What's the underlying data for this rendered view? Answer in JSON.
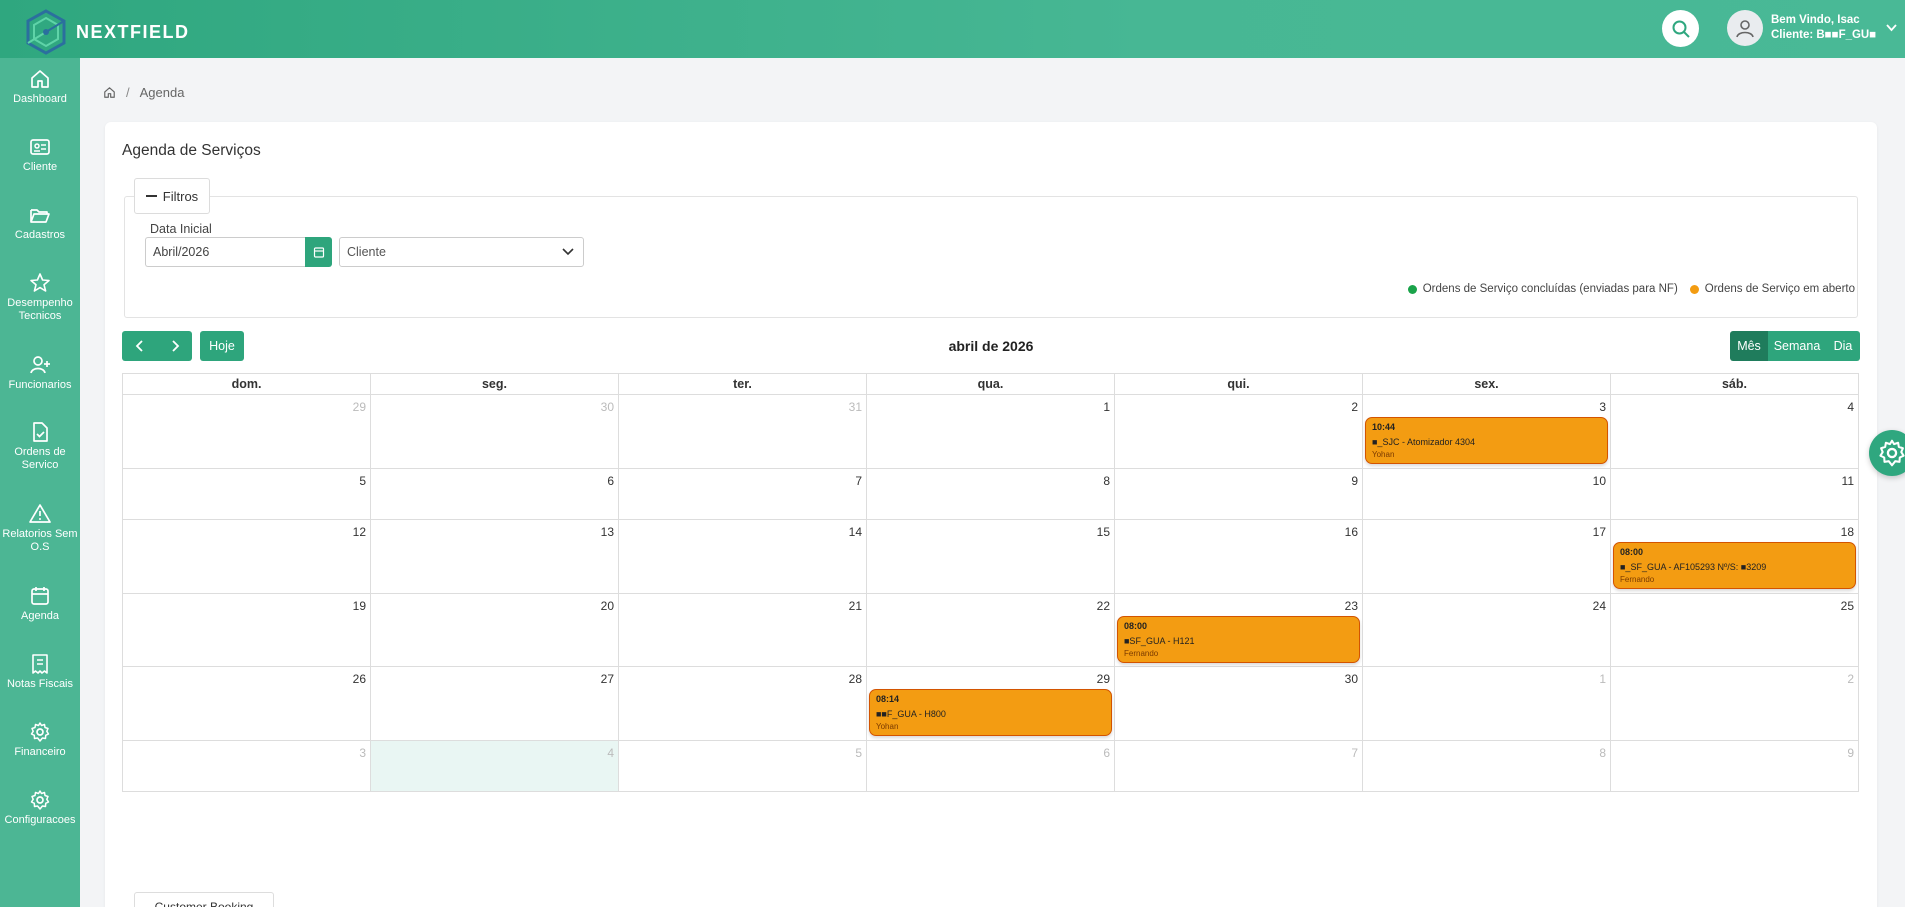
{
  "brand": {
    "name": "NEXTFIELD"
  },
  "user": {
    "greeting": "Bem Vindo, Isac",
    "client": "Cliente: B■■F_GU■"
  },
  "sidebar": {
    "items": [
      {
        "label": "Dashboard",
        "icon": "home-icon"
      },
      {
        "label": "Cliente",
        "icon": "id-card-icon"
      },
      {
        "label": "Cadastros",
        "icon": "folder-open-icon"
      },
      {
        "label": "Desempenho Tecnicos",
        "icon": "star-icon"
      },
      {
        "label": "Funcionarios",
        "icon": "user-plus-icon"
      },
      {
        "label": "Ordens de Servico",
        "icon": "file-check-icon"
      },
      {
        "label": "Relatorios Sem O.S",
        "icon": "warning-icon"
      },
      {
        "label": "Agenda",
        "icon": "calendar-icon"
      },
      {
        "label": "Notas Fiscais",
        "icon": "receipt-icon"
      },
      {
        "label": "Financeiro",
        "icon": "gear-icon"
      },
      {
        "label": "Configuracoes",
        "icon": "gear-icon"
      }
    ]
  },
  "breadcrumb": {
    "current": "Agenda"
  },
  "page": {
    "title": "Agenda de Serviços"
  },
  "filters": {
    "toggle_label": "Filtros",
    "date_label": "Data Inicial",
    "date_value": "Abril/2026",
    "client_placeholder": "Cliente",
    "legend": [
      {
        "label": "Ordens de Serviço concluídas (enviadas para NF)",
        "color": "#1aa34a"
      },
      {
        "label": "Ordens de Serviço em aberto",
        "color": "#f39c12"
      }
    ]
  },
  "calendar": {
    "today_label": "Hoje",
    "title": "abril de 2026",
    "views": [
      "Mês",
      "Semana",
      "Dia"
    ],
    "active_view": "Mês",
    "weekdays": [
      "dom.",
      "seg.",
      "ter.",
      "qua.",
      "qui.",
      "sex.",
      "sáb."
    ],
    "weeks": [
      {
        "days": [
          {
            "n": "29",
            "other": true
          },
          {
            "n": "30",
            "other": true
          },
          {
            "n": "31",
            "other": true
          },
          {
            "n": "1"
          },
          {
            "n": "2"
          },
          {
            "n": "3",
            "event": {
              "time": "10:44",
              "title": "■_SJC - Atomizador 4304",
              "tech": "Yohan"
            }
          },
          {
            "n": "4"
          }
        ]
      },
      {
        "days": [
          {
            "n": "5"
          },
          {
            "n": "6"
          },
          {
            "n": "7"
          },
          {
            "n": "8"
          },
          {
            "n": "9"
          },
          {
            "n": "10"
          },
          {
            "n": "11"
          }
        ]
      },
      {
        "days": [
          {
            "n": "12"
          },
          {
            "n": "13"
          },
          {
            "n": "14"
          },
          {
            "n": "15"
          },
          {
            "n": "16"
          },
          {
            "n": "17"
          },
          {
            "n": "18",
            "event": {
              "time": "08:00",
              "title": "■_SF_GUA - AF105293 Nº/S: ■3209",
              "tech": "Fernando"
            }
          }
        ]
      },
      {
        "days": [
          {
            "n": "19"
          },
          {
            "n": "20"
          },
          {
            "n": "21"
          },
          {
            "n": "22"
          },
          {
            "n": "23",
            "event": {
              "time": "08:00",
              "title": "■SF_GUA - H121",
              "tech": "Fernando"
            }
          },
          {
            "n": "24"
          },
          {
            "n": "25"
          }
        ]
      },
      {
        "days": [
          {
            "n": "26"
          },
          {
            "n": "27"
          },
          {
            "n": "28"
          },
          {
            "n": "29",
            "event": {
              "time": "08:14",
              "title": "■■F_GUA - H800",
              "tech": "Yohan"
            }
          },
          {
            "n": "30"
          },
          {
            "n": "1",
            "other": true
          },
          {
            "n": "2",
            "other": true
          }
        ]
      },
      {
        "days": [
          {
            "n": "3",
            "other": true
          },
          {
            "n": "4",
            "other": true,
            "today": true
          },
          {
            "n": "5",
            "other": true
          },
          {
            "n": "6",
            "other": true
          },
          {
            "n": "7",
            "other": true
          },
          {
            "n": "8",
            "other": true
          },
          {
            "n": "9",
            "other": true
          }
        ]
      }
    ]
  },
  "footer_button": {
    "label": "Customer Booking"
  }
}
